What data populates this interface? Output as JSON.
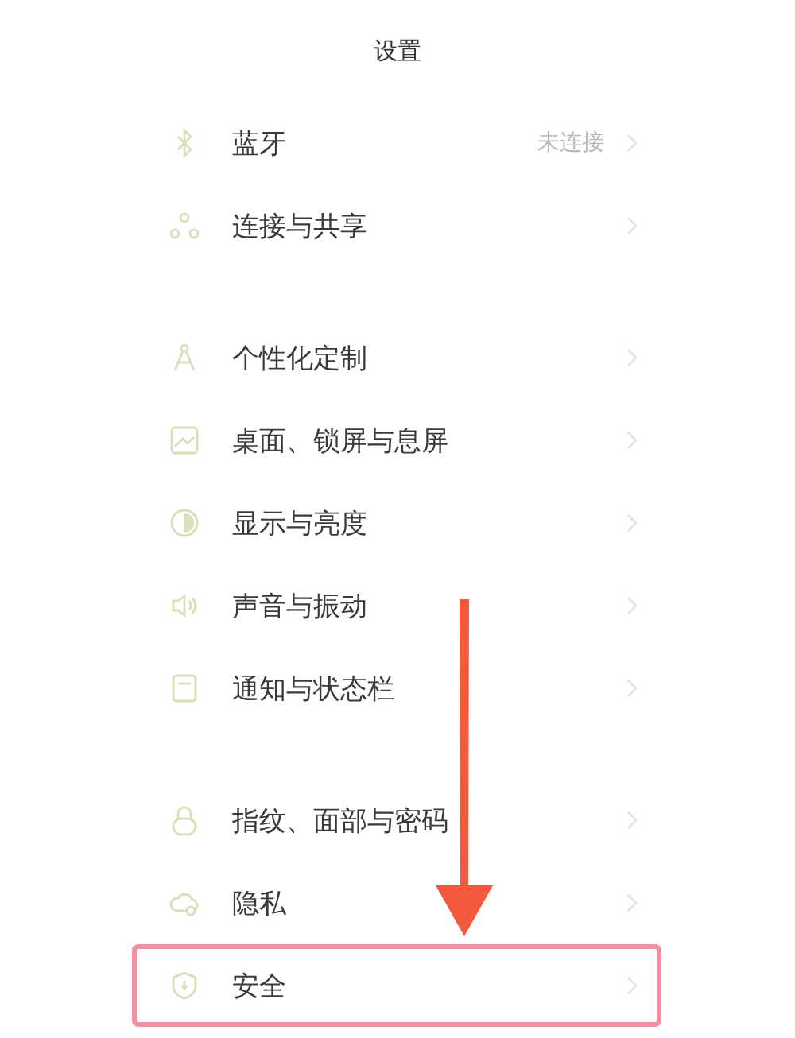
{
  "title": "设置",
  "groups": [
    {
      "items": [
        {
          "label": "蓝牙",
          "value": "未连接",
          "highlighted": false
        },
        {
          "label": "连接与共享",
          "highlighted": false
        }
      ]
    },
    {
      "items": [
        {
          "label": "个性化定制",
          "highlighted": false
        },
        {
          "label": "桌面、锁屏与息屏",
          "highlighted": false
        },
        {
          "label": "显示与亮度",
          "highlighted": false
        },
        {
          "label": "声音与振动",
          "highlighted": false
        },
        {
          "label": "通知与状态栏",
          "highlighted": false
        }
      ]
    },
    {
      "items": [
        {
          "label": "指纹、面部与密码",
          "highlighted": false
        },
        {
          "label": "隐私",
          "highlighted": false
        },
        {
          "label": "安全",
          "highlighted": true
        }
      ]
    }
  ]
}
